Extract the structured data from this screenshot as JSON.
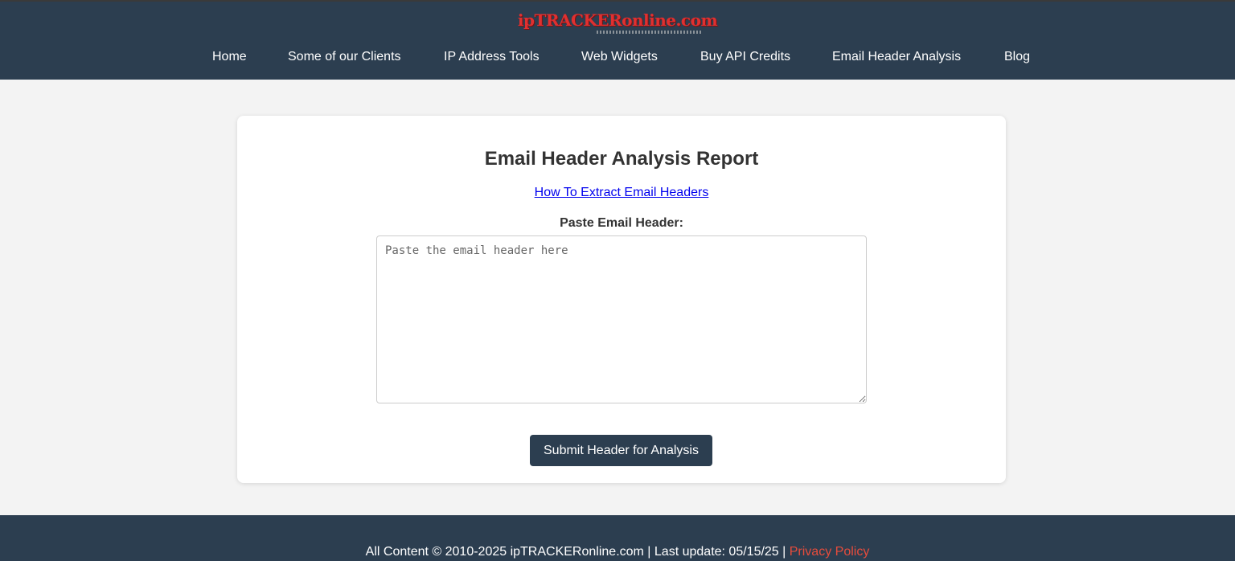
{
  "site": {
    "logo": "ipTRACKERonline.com"
  },
  "nav": {
    "items": [
      {
        "label": "Home"
      },
      {
        "label": "Some of our Clients"
      },
      {
        "label": "IP Address Tools"
      },
      {
        "label": "Web Widgets"
      },
      {
        "label": "Buy API Credits"
      },
      {
        "label": "Email Header Analysis"
      },
      {
        "label": "Blog"
      }
    ]
  },
  "main": {
    "title": "Email Header Analysis Report",
    "help_link": "How To Extract Email Headers",
    "paste_label": "Paste Email Header:",
    "textarea_placeholder": "Paste the email header here",
    "textarea_value": "",
    "submit_label": "Submit Header for Analysis"
  },
  "footer": {
    "text": "All Content © 2010-2025 ipTRACKERonline.com | Last update: 05/15/25 | ",
    "privacy_link": "Privacy Policy",
    "privacy_color": "#e74c3c"
  },
  "colors": {
    "header_bg": "#2c3e50",
    "page_bg": "#f3f3f3",
    "logo_red": "#e03030",
    "link_blue": "#0000ee"
  }
}
